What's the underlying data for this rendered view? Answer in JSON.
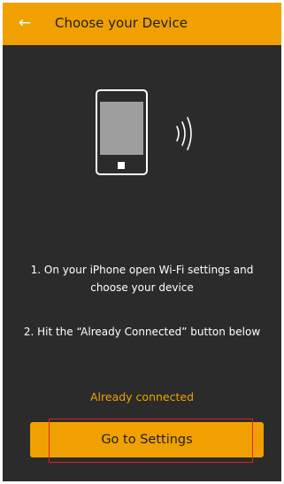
{
  "header": {
    "back_icon": "arrow-left-icon",
    "title": "Choose your Device"
  },
  "illustration": {
    "icons": [
      "smartphone-icon",
      "wifi-signal-icon"
    ]
  },
  "instructions": {
    "step1": "1. On your iPhone open Wi-Fi settings and choose your device",
    "step2": "2. Hit the “Already Connected” button below"
  },
  "actions": {
    "already_connected": "Already connected",
    "go_to_settings": "Go to Settings"
  },
  "colors": {
    "accent": "#f0a000",
    "background": "#2b2b2b",
    "highlight_border": "#e02020"
  }
}
